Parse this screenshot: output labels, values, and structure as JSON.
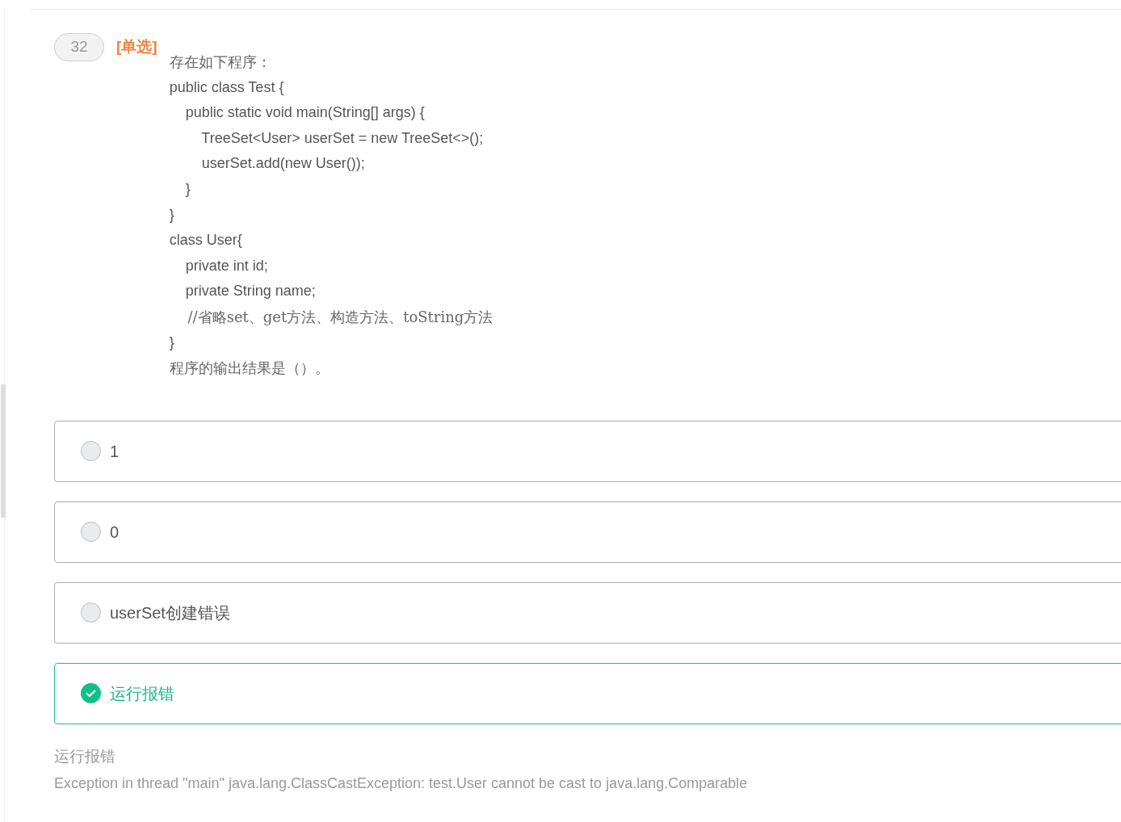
{
  "question": {
    "number": "32",
    "type_tag": "[单选]",
    "lines": [
      {
        "kind": "prose",
        "text": "存在如下程序："
      },
      {
        "kind": "code",
        "text": "public class Test {"
      },
      {
        "kind": "code",
        "text": "    public static void main(String[] args) {"
      },
      {
        "kind": "code",
        "text": "        TreeSet<User> userSet = new TreeSet<>();"
      },
      {
        "kind": "code",
        "text": "        userSet.add(new User());"
      },
      {
        "kind": "code",
        "text": "    }"
      },
      {
        "kind": "code",
        "text": "}"
      },
      {
        "kind": "code",
        "text": "class User{"
      },
      {
        "kind": "code",
        "text": "    private int id;"
      },
      {
        "kind": "code",
        "text": "    private String name;"
      },
      {
        "kind": "prose",
        "text": "    //省略set、get方法、构造方法、toString方法"
      },
      {
        "kind": "code",
        "text": "}"
      },
      {
        "kind": "prose",
        "text": "程序的输出结果是（）。"
      }
    ]
  },
  "options": [
    {
      "label": "1",
      "selected": false
    },
    {
      "label": "0",
      "selected": false
    },
    {
      "label": "userSet创建错误",
      "selected": false
    },
    {
      "label": "运行报错",
      "selected": true
    }
  ],
  "explanation": {
    "answer": "运行报错",
    "detail": "Exception in thread \"main\" java.lang.ClassCastException: test.User cannot be cast to java.lang.Comparable"
  }
}
